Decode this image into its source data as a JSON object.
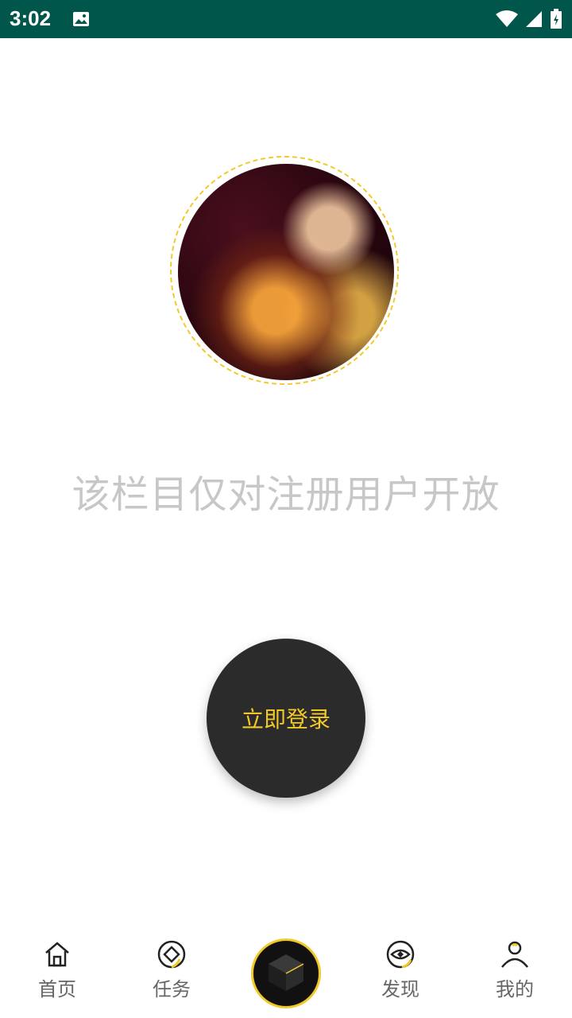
{
  "status": {
    "time": "3:02"
  },
  "main": {
    "message": "该栏目仅对注册用户开放",
    "login_label": "立即登录"
  },
  "nav": {
    "items": [
      {
        "label": "首页",
        "icon": "home-icon"
      },
      {
        "label": "任务",
        "icon": "task-icon"
      },
      {
        "label": "发现",
        "icon": "discover-icon"
      },
      {
        "label": "我的",
        "icon": "profile-icon"
      }
    ],
    "center_icon": "cube-icon"
  },
  "colors": {
    "accent": "#f3c928",
    "status_bar": "#00564a",
    "button": "#2b2b2b"
  }
}
